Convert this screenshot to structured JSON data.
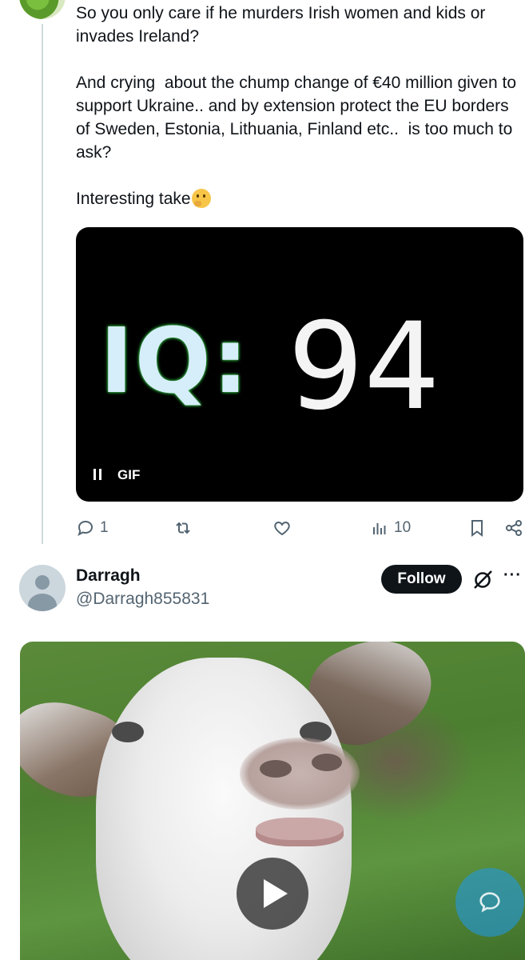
{
  "reply_tweet": {
    "paragraphs": [
      "So you only care if he murders Irish women and kids or invades Ireland?",
      "And crying  about the chump change of €40 million given to support Ukraine.. and by extension protect the EU borders of Sweden, Estonia, Lithuania, Finland etc..  is too much to ask?",
      "Interesting take"
    ],
    "gif": {
      "iq_label": "IQ:",
      "iq_value": "94",
      "badge": "GIF"
    },
    "actions": {
      "replies": "1",
      "views": "10"
    }
  },
  "next_tweet": {
    "name": "Darragh",
    "handle": "@Darragh855831",
    "follow_label": "Follow",
    "more_label": "···"
  },
  "colors": {
    "text_primary": "#0f1419",
    "text_secondary": "#536471",
    "accent": "#1d9bf0",
    "follow_bg": "#0f1419"
  },
  "icons": [
    "reply-icon",
    "retweet-icon",
    "like-icon",
    "views-icon",
    "bookmark-icon",
    "share-icon",
    "grok-icon",
    "more-icon",
    "play-icon",
    "pause-icon",
    "chat-icon"
  ]
}
